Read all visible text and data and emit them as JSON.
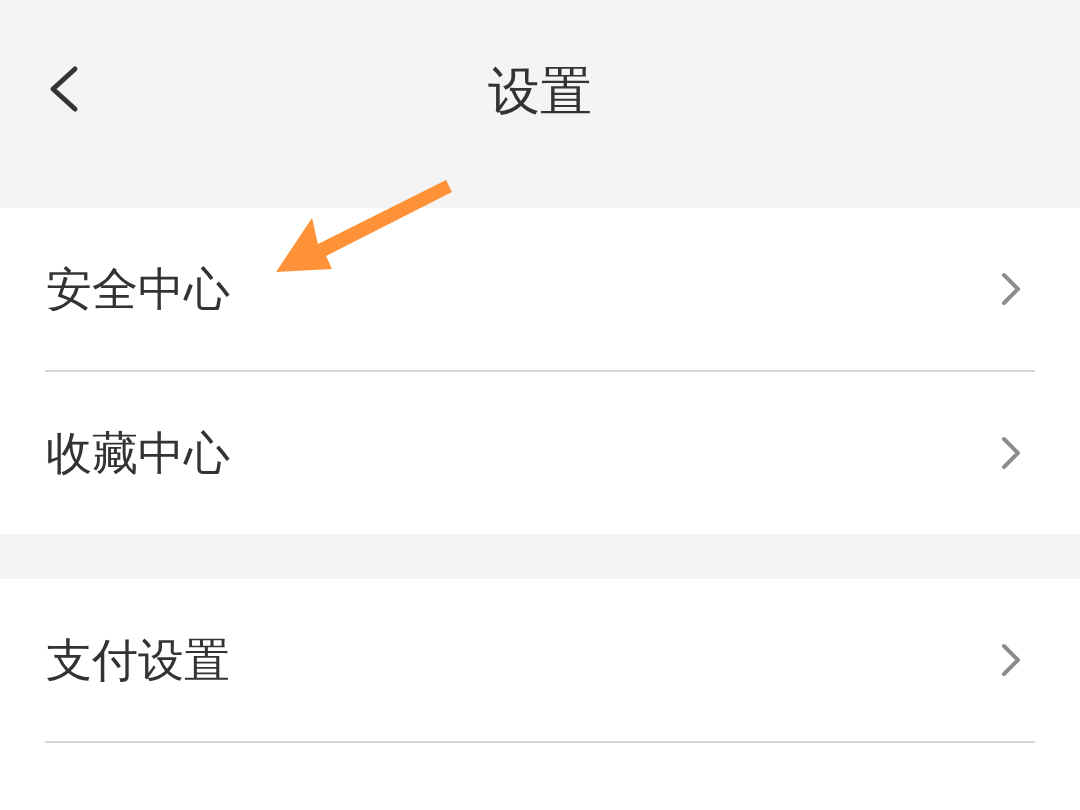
{
  "header": {
    "title": "设置"
  },
  "groups": [
    {
      "continues": false,
      "items": [
        {
          "label": "安全中心"
        },
        {
          "label": "收藏中心"
        }
      ]
    },
    {
      "continues": true,
      "items": [
        {
          "label": "支付设置"
        }
      ]
    }
  ]
}
